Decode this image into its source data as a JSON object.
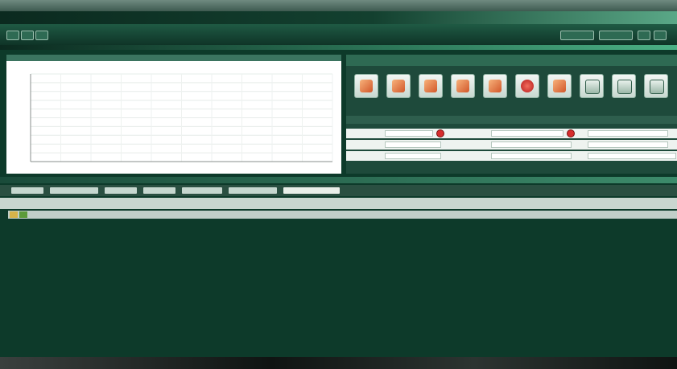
{
  "window": {
    "title": ""
  },
  "menu": {
    "items": [
      "",
      "",
      "",
      "",
      "",
      "",
      ""
    ]
  },
  "colors": {
    "background": "#0d3a2a",
    "accent": "#4bb085",
    "stop_button": "#d62d2d"
  },
  "chart_data": {
    "type": "line",
    "title": "",
    "xlabel": "",
    "ylabel": "",
    "series": [],
    "grid": true
  },
  "toolbar_icons": [
    {
      "name": "folder-icon"
    },
    {
      "name": "tool-icon"
    },
    {
      "name": "tool-icon"
    },
    {
      "name": "tool-icon"
    },
    {
      "name": "tool-icon"
    },
    {
      "name": "record-icon"
    },
    {
      "name": "tool-icon"
    },
    {
      "name": "document-icon"
    },
    {
      "name": "document-icon"
    },
    {
      "name": "document-icon"
    }
  ],
  "parameters": {
    "rows": 3,
    "fields_per_row": 3
  },
  "lower_tabs": [
    "",
    "",
    "",
    "",
    "",
    "",
    ""
  ],
  "table": {
    "columns": [],
    "rows": []
  },
  "status": {
    "text": ""
  }
}
